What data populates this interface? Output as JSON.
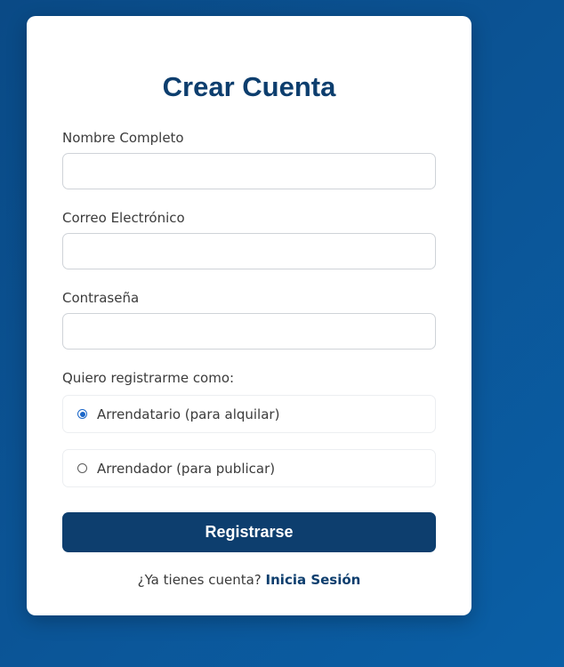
{
  "form": {
    "title": "Crear Cuenta",
    "fields": [
      {
        "label": "Nombre Completo",
        "value": "",
        "placeholder": ""
      },
      {
        "label": "Correo Electrónico",
        "value": "",
        "placeholder": ""
      },
      {
        "label": "Contraseña",
        "value": "",
        "placeholder": ""
      }
    ],
    "role_label": "Quiero registrarme como:",
    "roles": [
      {
        "label": "Arrendatario (para alquilar)",
        "selected": true
      },
      {
        "label": "Arrendador (para publicar)",
        "selected": false
      }
    ],
    "submit_label": "Registrarse",
    "footer_text": "¿Ya tienes cuenta?",
    "login_link": "Inicia Sesión"
  },
  "colors": {
    "primary": "#0d3e6e",
    "background": "#0a5596",
    "radio_accent": "#1a66c8"
  }
}
